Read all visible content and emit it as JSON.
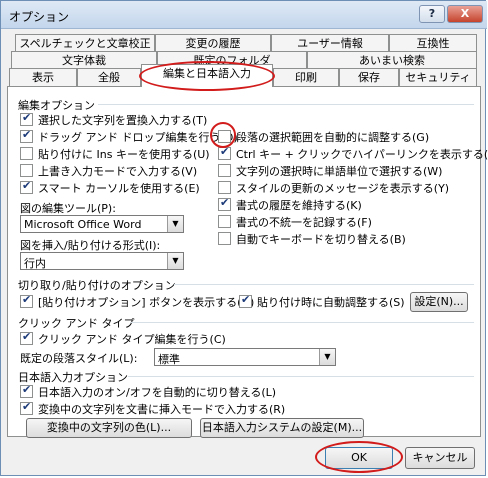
{
  "window": {
    "title": "オプション",
    "help": "?",
    "close": "X"
  },
  "tabs_row1": [
    "スペルチェックと文章校正",
    "変更の履歴",
    "ユーザー情報",
    "互換性"
  ],
  "tabs_row2": [
    "文字体裁",
    "既定のフォルダ",
    "あいまい検索"
  ],
  "tabs_row3": [
    "表示",
    "全般",
    "編集と日本語入力",
    "印刷",
    "保存",
    "セキュリティ"
  ],
  "edit": {
    "header": "編集オプション",
    "left": [
      {
        "label": "選択した文字列を置換入力する(T)",
        "checked": true
      },
      {
        "label": "ドラッグ アンド ドロップ編集を行う(D)",
        "checked": true
      },
      {
        "label": "貼り付けに Ins キーを使用する(U)",
        "checked": false
      },
      {
        "label": "上書き入力モードで入力する(V)",
        "checked": false
      },
      {
        "label": "スマート カーソルを使用する(E)",
        "checked": true
      }
    ],
    "right": [
      {
        "label": "段落の選択範囲を自動的に調整する(G)",
        "checked": false
      },
      {
        "label": "Ctrl キー + クリックでハイパーリンクを表示する(H)",
        "checked": true
      },
      {
        "label": "文字列の選択時に単語単位で選択する(W)",
        "checked": false
      },
      {
        "label": "スタイルの更新のメッセージを表示する(Y)",
        "checked": false
      },
      {
        "label": "書式の履歴を維持する(K)",
        "checked": true
      },
      {
        "label": "書式の不統一を記録する(F)",
        "checked": false
      },
      {
        "label": "自動でキーボードを切り替える(B)",
        "checked": false
      }
    ],
    "picture_editor_label": "図の編集ツール(P):",
    "picture_editor_value": "Microsoft Office Word",
    "insert_label": "図を挿入/貼り付ける形式(I):",
    "insert_value": "行内"
  },
  "cutpaste": {
    "header": "切り取り/貼り付けのオプション",
    "opt1": {
      "label": "[貼り付けオプション] ボタンを表示する(O)",
      "checked": true
    },
    "opt2": {
      "label": "貼り付け時に自動調整する(S)",
      "checked": true
    },
    "settings_btn": "設定(N)..."
  },
  "clicktype": {
    "header": "クリック アンド タイプ",
    "opt1": {
      "label": "クリック アンド タイプ編集を行う(C)",
      "checked": true
    },
    "style_label": "既定の段落スタイル(L):",
    "style_value": "標準"
  },
  "ime": {
    "header": "日本語入力オプション",
    "opt1": {
      "label": "日本語入力のオン/オフを自動的に切り替える(L)",
      "checked": true
    },
    "opt2": {
      "label": "変換中の文字列を文書に挿入モードで入力する(R)",
      "checked": true
    },
    "color_btn": "変換中の文字列の色(L)...",
    "settings_btn": "日本語入力システムの設定(M)..."
  },
  "footer": {
    "ok": "OK",
    "cancel": "キャンセル"
  }
}
